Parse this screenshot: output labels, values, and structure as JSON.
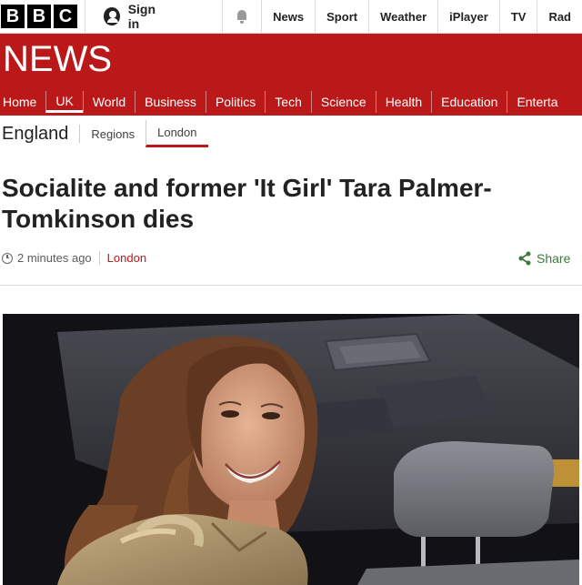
{
  "topbar": {
    "logo_letters": [
      "B",
      "B",
      "C"
    ],
    "signin_label": "Sign in",
    "links": [
      "News",
      "Sport",
      "Weather",
      "iPlayer",
      "TV",
      "Rad"
    ]
  },
  "header": {
    "title": "NEWS",
    "nav": [
      "Home",
      "UK",
      "World",
      "Business",
      "Politics",
      "Tech",
      "Science",
      "Health",
      "Education",
      "Enterta"
    ],
    "active_nav": "UK"
  },
  "subnav": {
    "region": "England",
    "items": [
      "Regions",
      "London"
    ],
    "active": "London"
  },
  "article": {
    "headline": "Socialite and former 'It Girl' Tara Palmer-Tomkinson dies",
    "time": "2 minutes ago",
    "location": "London",
    "share_label": "Share"
  },
  "colors": {
    "brand_red": "#bb1919",
    "share_green": "#3a7a3a"
  }
}
